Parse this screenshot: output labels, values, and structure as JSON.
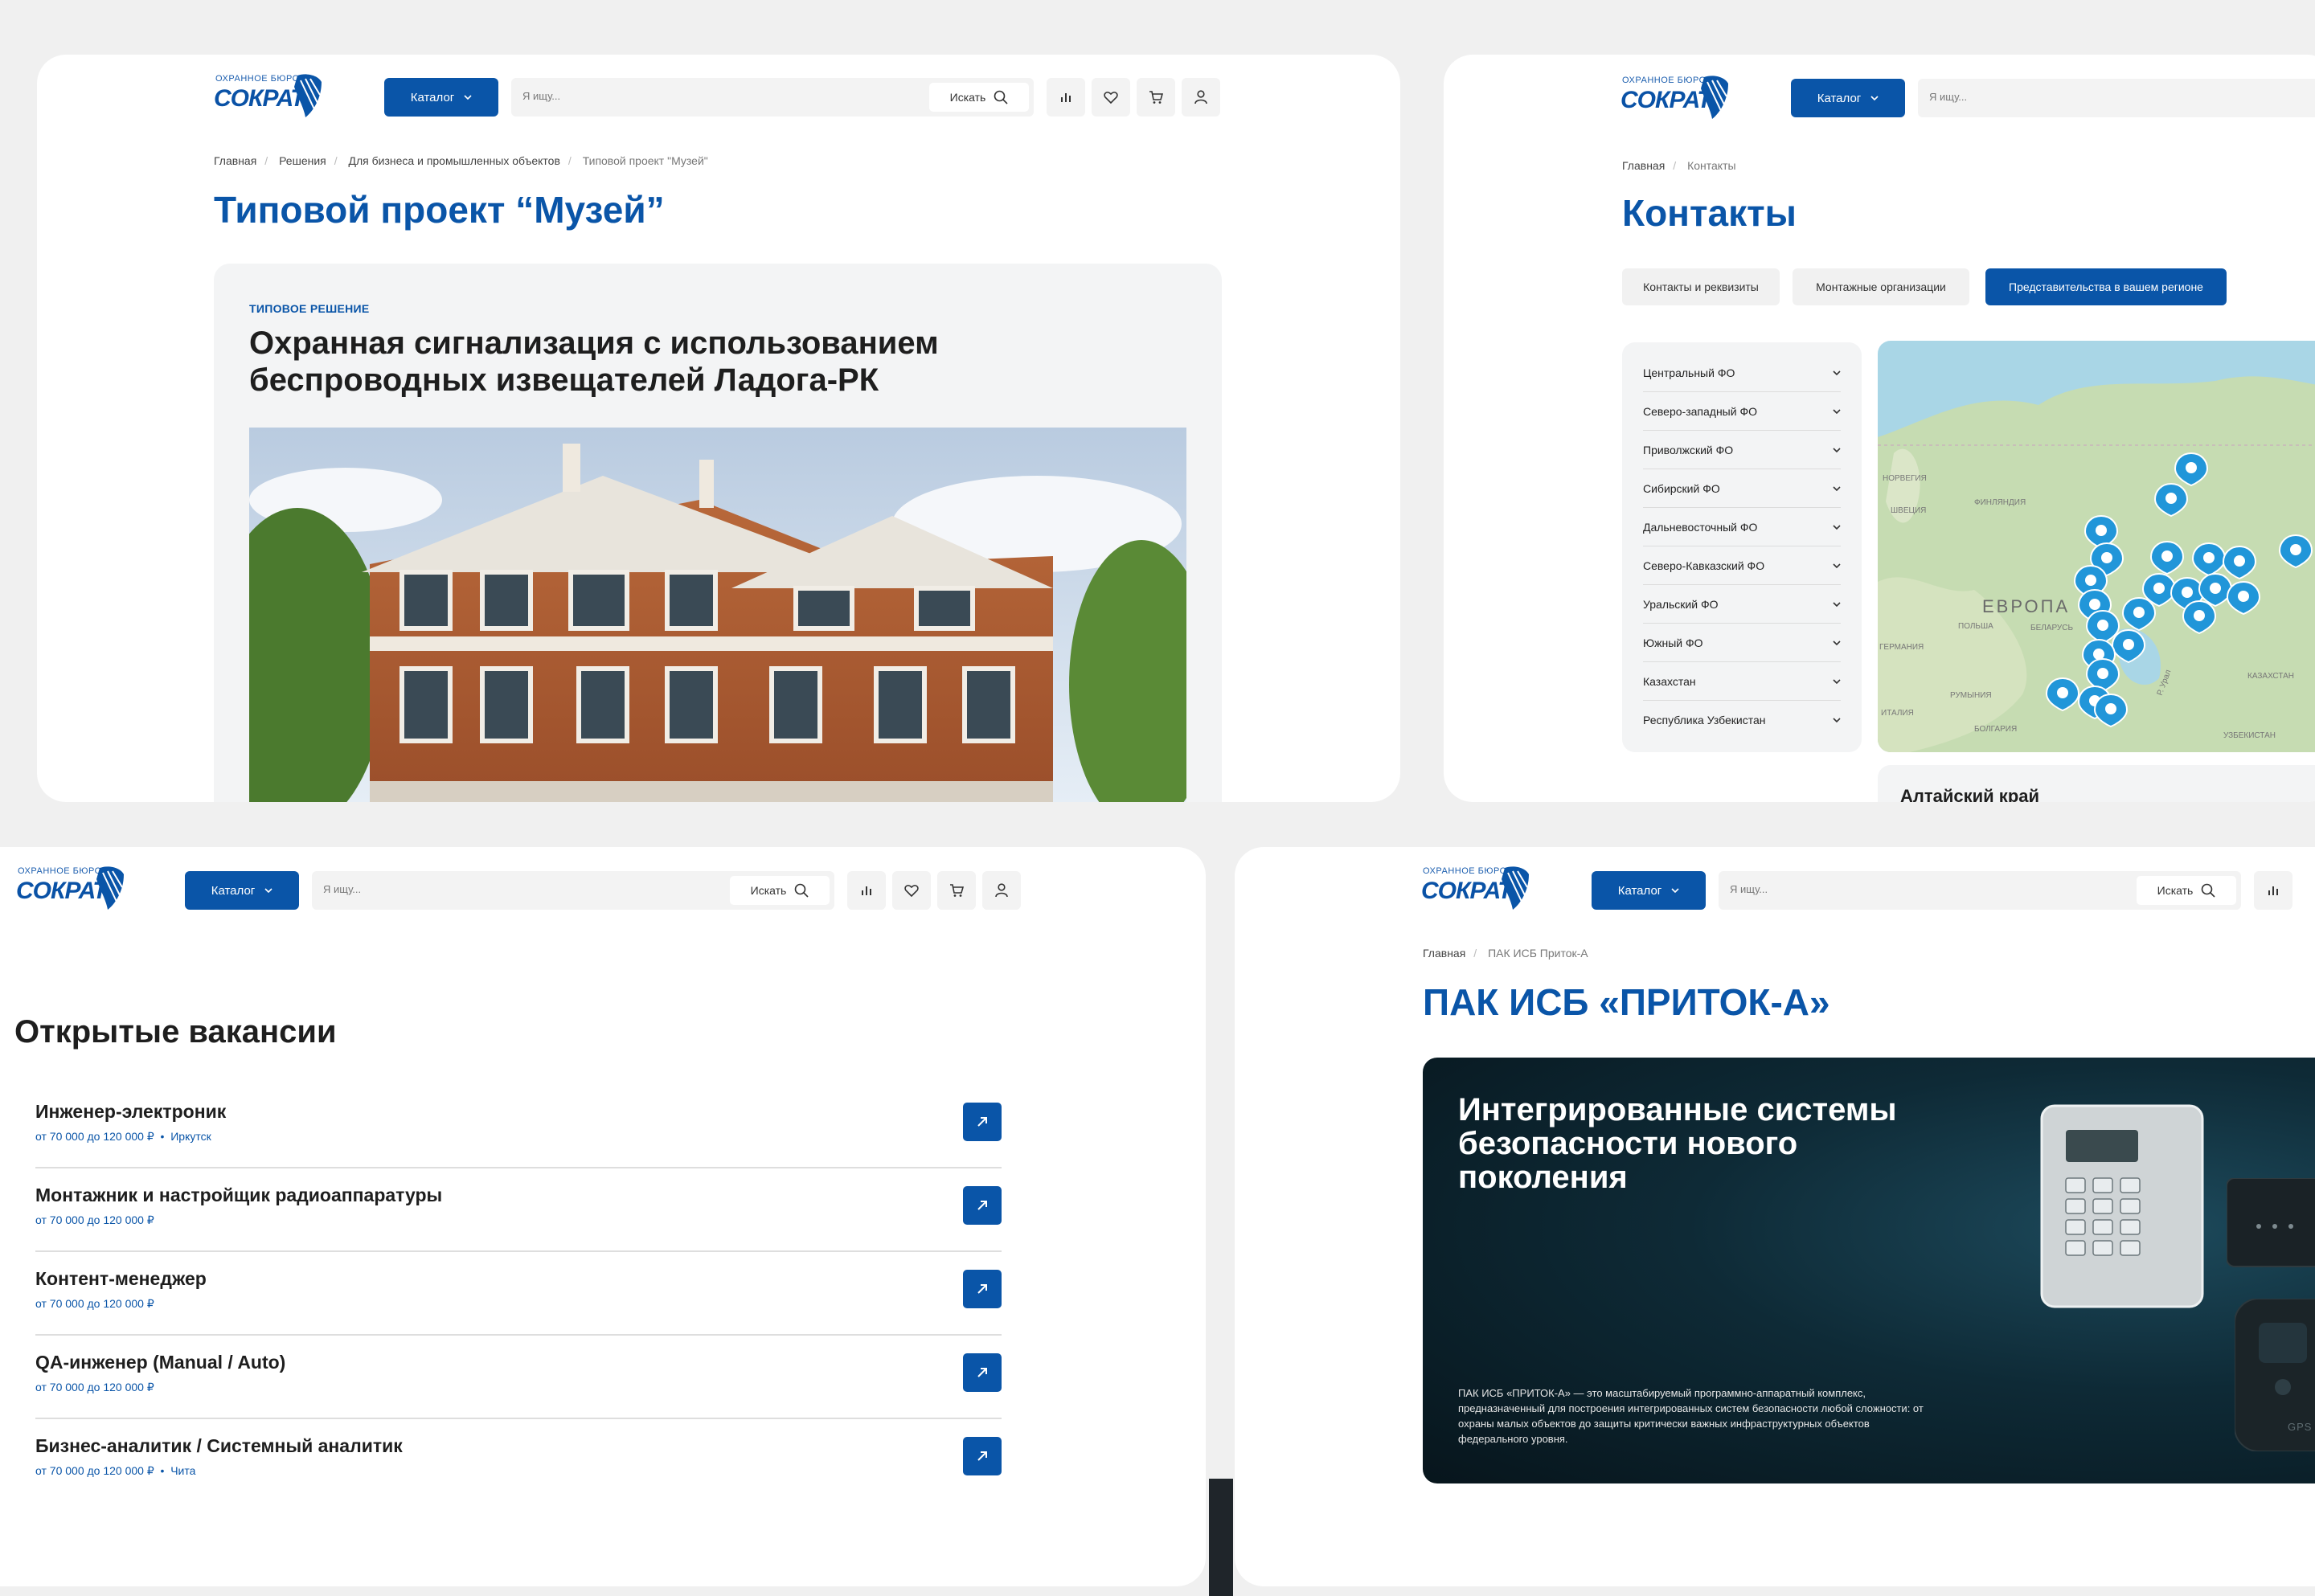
{
  "header": {
    "logo_top": "ОХРАННОЕ БЮРО",
    "logo_main": "СОКРАТ",
    "catalog_label": "Каталог",
    "search_placeholder": "Я ищу...",
    "search_button": "Искать"
  },
  "project_page": {
    "breadcrumbs": [
      "Главная",
      "Решения",
      "Для бизнеса и промышленных объектов",
      "Типовой проект \"Музей\""
    ],
    "title": "Типовой проект “Музей”",
    "tag": "ТИПОВОЕ РЕШЕНИЕ",
    "heading_line1": "Охранная сигнализация  с использованием",
    "heading_line2": "беспроводных извещателей Ладога-РК"
  },
  "contacts_page": {
    "breadcrumbs": [
      "Главная",
      "Контакты"
    ],
    "title": "Контакты",
    "tabs": [
      {
        "label": "Контакты и реквизиты",
        "active": false
      },
      {
        "label": "Монтажные организации",
        "active": false
      },
      {
        "label": "Представительства в вашем регионе",
        "active": true
      }
    ],
    "regions": [
      "Центральный ФО",
      "Северо-западный ФО",
      "Приволжский ФО",
      "Сибирский ФО",
      "Дальневосточный ФО",
      "Северо-Кавказский ФО",
      "Уральский ФО",
      "Южный ФО",
      "Казахстан",
      "Республика Узбекистан"
    ],
    "map_labels": [
      "НОРВЕГИЯ",
      "ШВЕЦИЯ",
      "ФИНЛЯНДИЯ",
      "ЕВРОПА",
      "БЕЛАРУСЬ",
      "ПОЛЬША",
      "ГЕРМАНИЯ",
      "РУМЫНИЯ",
      "ИТАЛИЯ",
      "БОЛГАРИЯ",
      "КАЗАХСТАН",
      "УЗБЕКИСТАН",
      "Р. Урал"
    ],
    "selected_region": "Алтайский край"
  },
  "vacancies_page": {
    "title": "Открытые вакансии",
    "items": [
      {
        "name": "Инженер-электроник",
        "salary": "от 70 000 до 120 000 ₽",
        "city": "Иркутск"
      },
      {
        "name": "Монтажник и настройщик радиоаппаратуры",
        "salary": "от 70 000 до 120 000 ₽",
        "city": ""
      },
      {
        "name": "Контент-менеджер",
        "salary": "от 70 000 до 120 000 ₽",
        "city": ""
      },
      {
        "name": "QA-инженер (Manual / Auto)",
        "salary": "от 70 000 до 120 000 ₽",
        "city": ""
      },
      {
        "name": "Бизнес-аналитик / Системный аналитик",
        "salary": "от 70 000 до 120 000 ₽",
        "city": "Чита"
      }
    ]
  },
  "product_page": {
    "breadcrumbs": [
      "Главная",
      "ПАК ИСБ Приток-А"
    ],
    "title": "ПАК ИСБ «ПРИТОК-А»",
    "hero_line1": "Интегрированные системы",
    "hero_line2": "безопасности нового",
    "hero_line3": "поколения",
    "hero_desc": "ПАК ИСБ «ПРИТОК-А» — это масштабируемый программно-аппаратный комплекс, предназначенный для построения интегрированных систем безопасности любой сложности: от охраны малых объектов до защиты критически важных инфраструктурных объектов федерального уровня.",
    "device_label": "GPS"
  },
  "colors": {
    "brand": "#0a55a8",
    "bg": "#f0f0f0",
    "panel": "#f3f4f5",
    "map_pin": "#2196d9"
  }
}
